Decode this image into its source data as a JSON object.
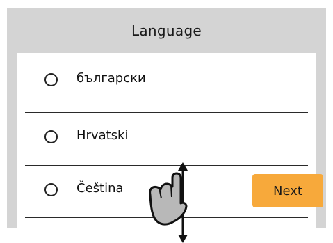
{
  "dialog": {
    "title": "Language",
    "options": [
      {
        "label": "български",
        "selected": false
      },
      {
        "label": "Hrvatski",
        "selected": false
      },
      {
        "label": "Čeština",
        "selected": false
      }
    ],
    "next_label": "Next"
  },
  "colors": {
    "panel_bg": "#d4d4d4",
    "list_bg": "#ffffff",
    "next_button": "#f7a93b"
  },
  "icons": {
    "gesture": "hand-drag-vertical-icon",
    "radio": "radio-unchecked-icon"
  }
}
